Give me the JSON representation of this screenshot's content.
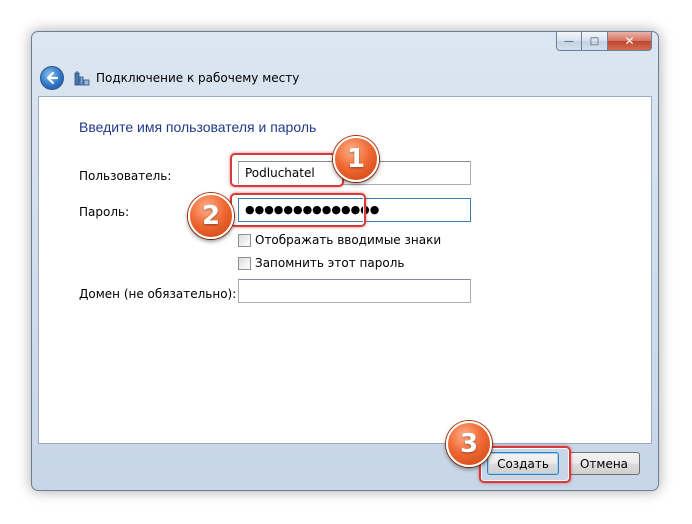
{
  "window": {
    "title": "Подключение к рабочему месту",
    "minimize_glyph": "—",
    "maximize_glyph": "□",
    "close_glyph": "✕"
  },
  "form": {
    "heading": "Введите имя пользователя и пароль",
    "user_label": "Пользователь:",
    "user_value": "Podluchatel",
    "password_label": "Пароль:",
    "password_value": "●●●●●●●●●●●●●●",
    "show_chars_label": "Отображать вводимые знаки",
    "remember_label": "Запомнить этот пароль",
    "domain_label": "Домен (не обязательно):",
    "domain_value": ""
  },
  "buttons": {
    "create": "Создать",
    "cancel": "Отмена"
  },
  "annotations": {
    "badge1": "1",
    "badge2": "2",
    "badge3": "3",
    "color": "#d63b3b",
    "badge_color": "#f06a35"
  },
  "colors": {
    "heading": "#1e3a8a",
    "frame": "#cfdceb",
    "close": "#c0452e"
  }
}
